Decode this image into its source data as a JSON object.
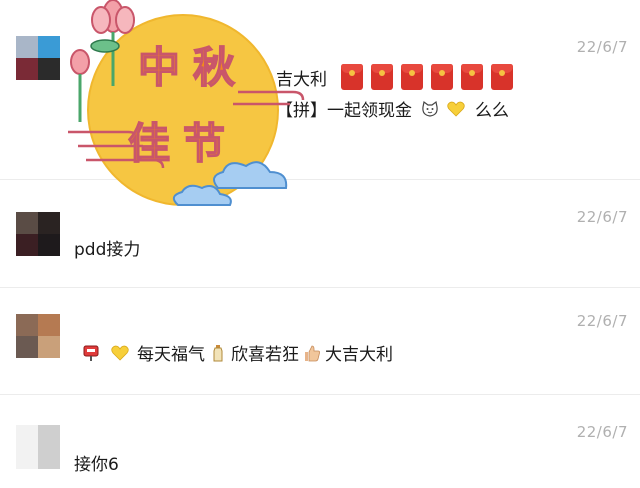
{
  "chat": {
    "messages": [
      {
        "time": "22/6/7",
        "line1": "吉大利",
        "line2": "【拼】一起领现金",
        "line2_suffix": "么么",
        "sticker_text": [
          "中",
          "秋",
          "佳",
          "节"
        ]
      },
      {
        "time": "22/6/7",
        "text": "pdd接力"
      },
      {
        "time": "22/6/7",
        "parts": [
          "每天福气",
          "欣喜若狂",
          "大吉大利"
        ]
      },
      {
        "time": "22/6/7",
        "text": "接你6"
      }
    ]
  },
  "colors": {
    "moon": "#f6c642",
    "sticker_text": "#f08a1e",
    "lotus": "#f3a0a8",
    "cloud": "#a6cdf2",
    "red_packet": "#d8332a"
  }
}
